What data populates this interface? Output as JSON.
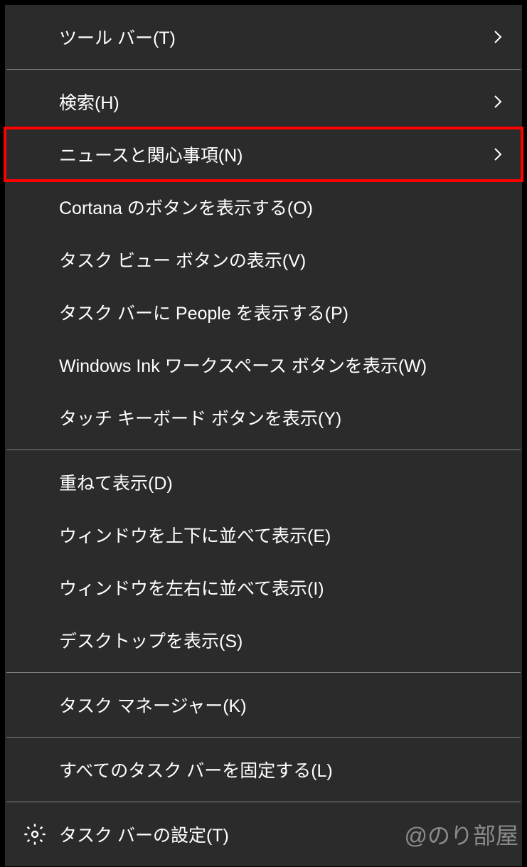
{
  "menu": {
    "groups": [
      [
        {
          "label": "ツール バー(T)",
          "hasSubmenu": true,
          "highlighted": false,
          "icon": null
        }
      ],
      [
        {
          "label": "検索(H)",
          "hasSubmenu": true,
          "highlighted": false,
          "icon": null
        },
        {
          "label": "ニュースと関心事項(N)",
          "hasSubmenu": true,
          "highlighted": true,
          "icon": null
        },
        {
          "label": "Cortana のボタンを表示する(O)",
          "hasSubmenu": false,
          "highlighted": false,
          "icon": null
        },
        {
          "label": "タスク ビュー ボタンの表示(V)",
          "hasSubmenu": false,
          "highlighted": false,
          "icon": null
        },
        {
          "label": "タスク バーに People を表示する(P)",
          "hasSubmenu": false,
          "highlighted": false,
          "icon": null
        },
        {
          "label": "Windows Ink ワークスペース ボタンを表示(W)",
          "hasSubmenu": false,
          "highlighted": false,
          "icon": null
        },
        {
          "label": "タッチ キーボード ボタンを表示(Y)",
          "hasSubmenu": false,
          "highlighted": false,
          "icon": null
        }
      ],
      [
        {
          "label": "重ねて表示(D)",
          "hasSubmenu": false,
          "highlighted": false,
          "icon": null
        },
        {
          "label": "ウィンドウを上下に並べて表示(E)",
          "hasSubmenu": false,
          "highlighted": false,
          "icon": null
        },
        {
          "label": "ウィンドウを左右に並べて表示(I)",
          "hasSubmenu": false,
          "highlighted": false,
          "icon": null
        },
        {
          "label": "デスクトップを表示(S)",
          "hasSubmenu": false,
          "highlighted": false,
          "icon": null
        }
      ],
      [
        {
          "label": "タスク マネージャー(K)",
          "hasSubmenu": false,
          "highlighted": false,
          "icon": null
        }
      ],
      [
        {
          "label": "すべてのタスク バーを固定する(L)",
          "hasSubmenu": false,
          "highlighted": false,
          "icon": null
        }
      ],
      [
        {
          "label": "タスク バーの設定(T)",
          "hasSubmenu": false,
          "highlighted": false,
          "icon": "gear"
        }
      ]
    ]
  },
  "watermark": "@のり部屋"
}
